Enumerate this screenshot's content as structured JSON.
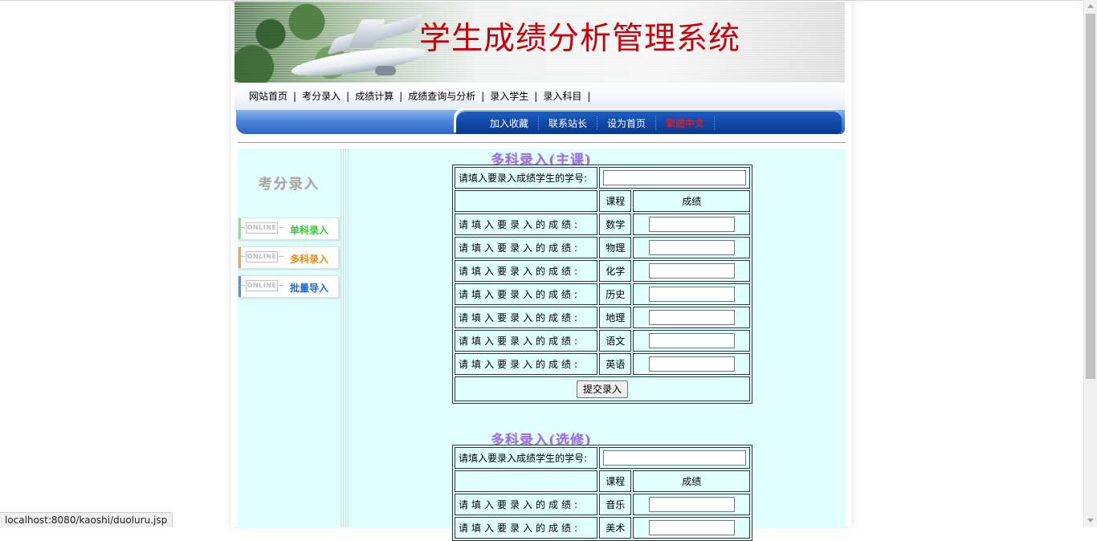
{
  "banner": {
    "title": "学生成绩分析管理系统"
  },
  "nav": {
    "links": [
      "网站首页",
      "考分录入",
      "成绩计算",
      "成绩查询与分析",
      "录入学生",
      "录入科目"
    ],
    "tabs": [
      "加入收藏",
      "联系站长",
      "设为首页",
      "繁體中文"
    ]
  },
  "sidebar": {
    "title": "考分录入",
    "online_badge": "ONLINE",
    "items": [
      {
        "label": "单科录入",
        "color": "#2bd12b",
        "bar_color": "#87e887"
      },
      {
        "label": "多科录入",
        "color": "#ee8a16",
        "bar_color": "#f3a640"
      },
      {
        "label": "批量导入",
        "color": "#1a6be0",
        "bar_color": "#4f8ff0"
      }
    ]
  },
  "main_form": {
    "title": "多科录入(主课)",
    "student_id_label": "请填入要录入成绩学生的学号:",
    "student_id_value": "",
    "header_course": "课程",
    "header_score": "成绩",
    "row_label": "请填入要录入的成绩:",
    "subjects": [
      "数学",
      "物理",
      "化学",
      "历史",
      "地理",
      "语文",
      "英语"
    ],
    "submit_label": "提交录入"
  },
  "elective_form": {
    "title": "多科录入(选修)",
    "student_id_label": "请填入要录入成绩学生的学号:",
    "student_id_value": "",
    "header_course": "课程",
    "header_score": "成绩",
    "row_label": "请填入要录入的成绩:",
    "subjects": [
      "音乐",
      "美术"
    ]
  },
  "status_bar": {
    "url": "localhost:8080/kaoshi/duoluru.jsp"
  }
}
